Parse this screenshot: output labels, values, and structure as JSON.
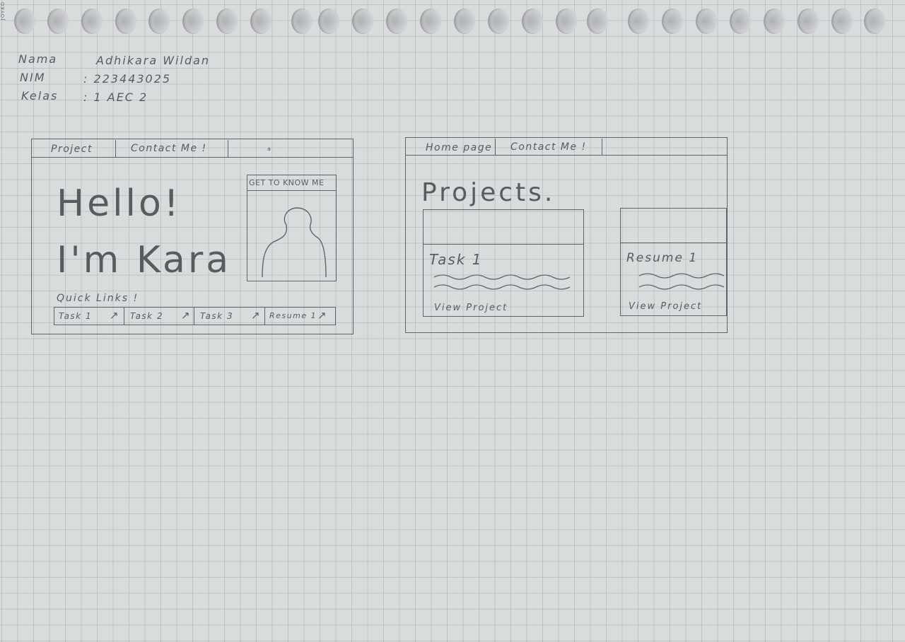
{
  "vendor": "JOYKO",
  "student": {
    "name_label": "Nama",
    "name_value": "Adhikara Wildan",
    "nim_label": "NIM",
    "nim_value": ": 223443025",
    "class_label": "Kelas",
    "class_value": ": 1 AEC 2"
  },
  "homepage_sketch": {
    "nav": [
      "Project",
      "Contact Me !"
    ],
    "hello_line1": "Hello!",
    "hello_line2": "I'm Kara",
    "profile_heading": "GET TO KNOW ME",
    "quick_links_label": "Quick Links !",
    "quick_links": [
      "Task 1",
      "Task 2",
      "Task 3",
      "Resume 1"
    ],
    "arrow_glyph": "↗"
  },
  "projects_sketch": {
    "nav": [
      "Home page",
      "Contact Me !"
    ],
    "title": "Projects.",
    "cards": [
      {
        "title": "Task 1",
        "link": "View Project"
      },
      {
        "title": "Resume 1",
        "link": "View Project"
      }
    ]
  },
  "colors": {
    "paper": "#d9dcdd",
    "pencil": "#575c60",
    "grid": "#9aa1a5"
  }
}
